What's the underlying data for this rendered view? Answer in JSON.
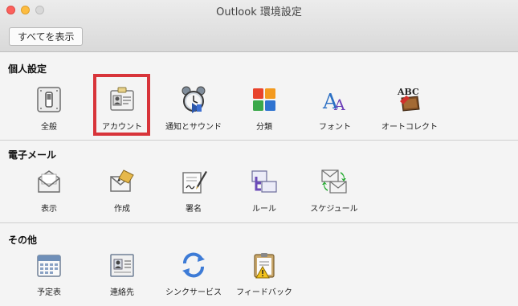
{
  "window": {
    "title": "Outlook 環境設定",
    "show_all_label": "すべてを表示"
  },
  "sections": {
    "personal": {
      "title": "個人設定",
      "items": [
        {
          "label": "全般",
          "icon": "general-switch-icon"
        },
        {
          "label": "アカウント",
          "icon": "account-card-icon"
        },
        {
          "label": "通知とサウンド",
          "icon": "notification-alarm-icon"
        },
        {
          "label": "分類",
          "icon": "category-squares-icon"
        },
        {
          "label": "フォント",
          "icon": "font-icon"
        },
        {
          "label": "オートコレクト",
          "icon": "autocorrect-abc-icon"
        }
      ]
    },
    "email": {
      "title": "電子メール",
      "items": [
        {
          "label": "表示",
          "icon": "reading-envelope-icon"
        },
        {
          "label": "作成",
          "icon": "compose-envelope-icon"
        },
        {
          "label": "署名",
          "icon": "signature-pen-icon"
        },
        {
          "label": "ルール",
          "icon": "rules-icon"
        },
        {
          "label": "スケジュール",
          "icon": "schedule-envelopes-icon"
        }
      ]
    },
    "other": {
      "title": "その他",
      "items": [
        {
          "label": "予定表",
          "icon": "calendar-icon"
        },
        {
          "label": "連絡先",
          "icon": "contacts-icon"
        },
        {
          "label": "シンクサービス",
          "icon": "sync-icon"
        },
        {
          "label": "フィードバック",
          "icon": "feedback-clipboard-icon"
        }
      ]
    }
  },
  "colors": {
    "highlight_box": "#d8343a"
  }
}
